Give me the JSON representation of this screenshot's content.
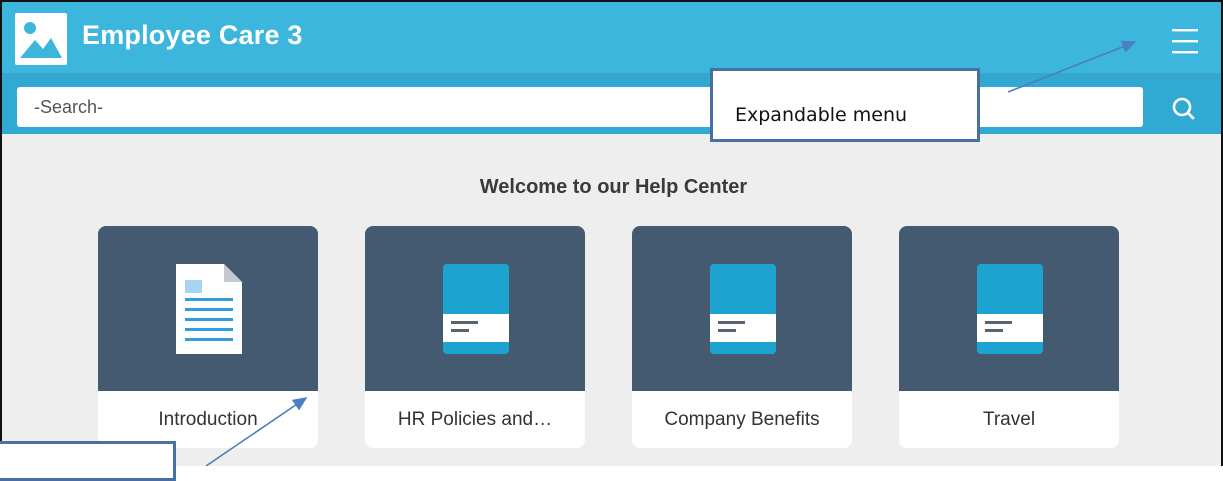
{
  "header": {
    "title": "Employee Care 3",
    "logo_icon": "image-placeholder-icon",
    "menu_icon": "hamburger-icon"
  },
  "search": {
    "placeholder": "-Search-",
    "value": "",
    "icon": "search-icon"
  },
  "main": {
    "welcome": "Welcome to our Help Center",
    "cards": [
      {
        "label": "Introduction",
        "icon": "document-icon"
      },
      {
        "label": "HR Policies and…",
        "icon": "book-icon"
      },
      {
        "label": "Company Benefits",
        "icon": "book-icon"
      },
      {
        "label": "Travel",
        "icon": "book-icon"
      }
    ]
  },
  "annotations": {
    "menu_callout": "Expandable menu",
    "card_callout": ""
  },
  "colors": {
    "header_blue": "#3cb6dc",
    "search_bar_blue": "#30a9d3",
    "card_art": "#435a71",
    "page_background": "#eeeeee",
    "callout_border": "#4a6fa5"
  }
}
